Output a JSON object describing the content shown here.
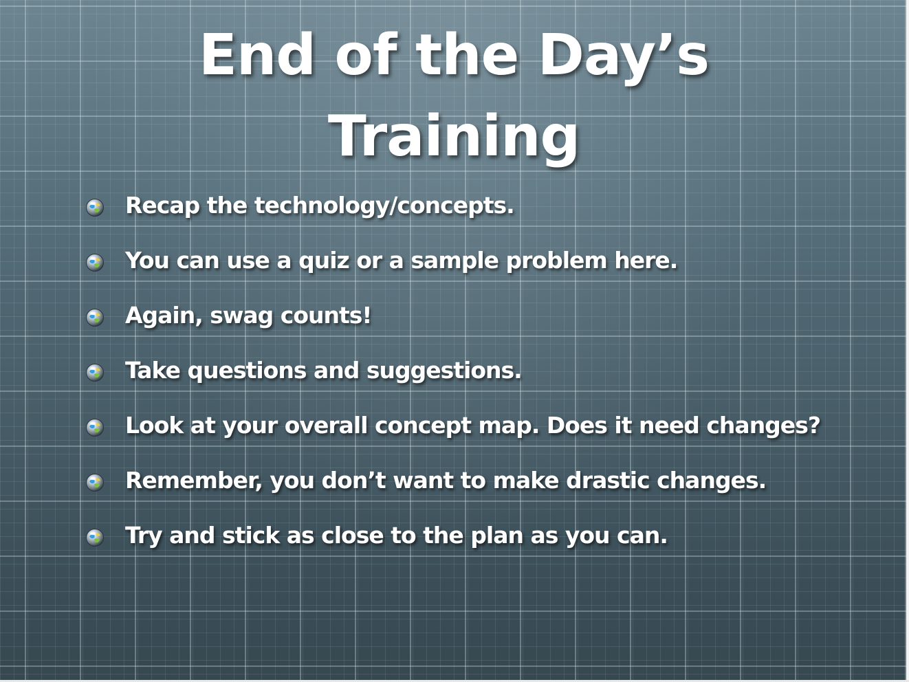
{
  "slide": {
    "title_lines": [
      "End of the Day’s",
      "Training"
    ],
    "bullets": [
      "Recap the technology/concepts.",
      "You can use a quiz or a sample problem here.",
      "Again, swag counts!",
      "Take questions and suggestions.",
      "Look at your overall concept map.  Does it need changes?",
      "Remember, you don’t want to make drastic changes.",
      "Try and stick as close to the plan as you can."
    ],
    "bullet_icon": "globe-marble-icon",
    "colors": {
      "background_top": "#6d8591",
      "background_bottom": "#36474f",
      "text": "#ffffff",
      "grid_line": "#dcebf0"
    }
  }
}
